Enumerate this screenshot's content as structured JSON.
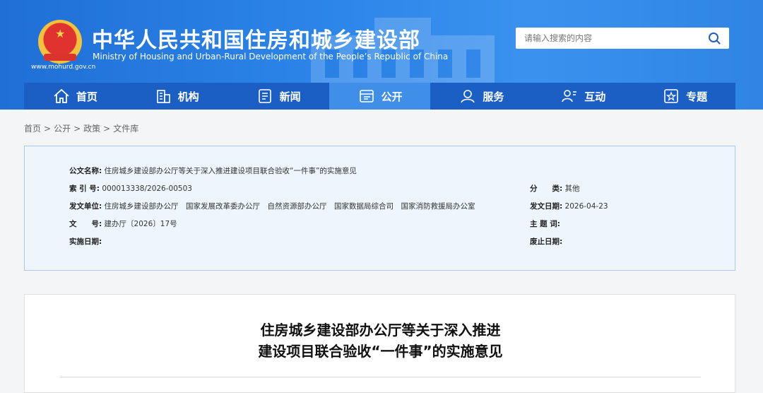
{
  "header": {
    "title": "中华人民共和国住房和城乡建设部",
    "subtitle": "Ministry of Housing and Urban-Rural Development of the People’s Republic of China",
    "url": "www.mohurd.gov.cn",
    "search_placeholder": "请输入搜索的内容"
  },
  "nav": {
    "items": [
      {
        "label": "首页",
        "icon": "home-icon"
      },
      {
        "label": "机构",
        "icon": "building-icon"
      },
      {
        "label": "新闻",
        "icon": "news-icon"
      },
      {
        "label": "公开",
        "icon": "disclosure-icon",
        "active": true
      },
      {
        "label": "服务",
        "icon": "service-icon"
      },
      {
        "label": "互动",
        "icon": "interaction-icon"
      },
      {
        "label": "专题",
        "icon": "topic-icon"
      }
    ]
  },
  "breadcrumb": [
    "首页",
    "公开",
    "政策",
    "文件库"
  ],
  "breadcrumb_sep": ">",
  "meta": {
    "title_label": "公文名称:",
    "title_value": "住房城乡建设部办公厅等关于深入推进建设项目联合验收“一件事”的实施意见",
    "index_label": "索 引 号:",
    "index_value": "000013338/2026-00503",
    "category_label": "分　　类:",
    "category_value": "其他",
    "issuer_label": "发文单位:",
    "issuer_value": "住房城乡建设部办公厅　国家发展改革委办公厅　自然资源部办公厅　国家数据局综合司　国家消防救援局办公室",
    "date_label": "发文日期:",
    "date_value": "2026-04-23",
    "docno_label": "文　　号:",
    "docno_value": "建办厅〔2026〕17号",
    "keywords_label": "主 题 词:",
    "keywords_value": "",
    "effective_label": "实施日期:",
    "effective_value": "",
    "expire_label": "废止日期:",
    "expire_value": ""
  },
  "document": {
    "title_line1": "住房城乡建设部办公厅等关于深入推进",
    "title_line2": "建设项目联合验收“一件事”的实施意见"
  },
  "colors": {
    "header_blue": "#2d86ea",
    "nav_blue": "#1b5fc4",
    "nav_active": "#3f8ee8",
    "meta_bg": "#eef5fc"
  }
}
